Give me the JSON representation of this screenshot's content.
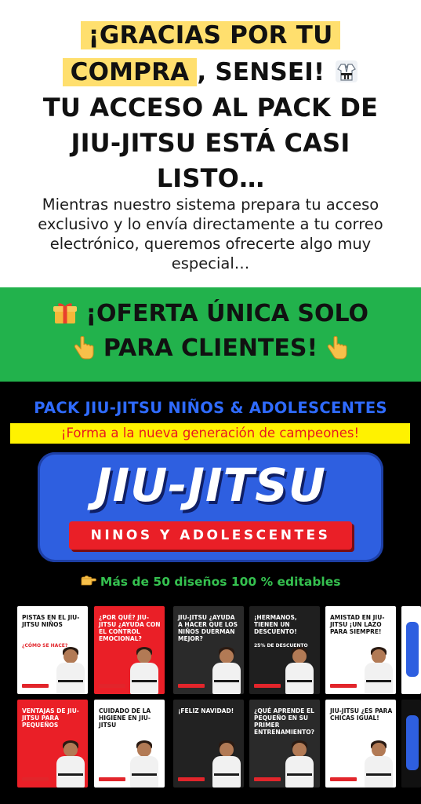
{
  "hero": {
    "line1": "¡GRACIAS POR TU",
    "line2_highlight": "COMPRA",
    "line2_rest": ", SENSEI!",
    "line3": "TU ACCESO AL PACK DE",
    "line4": "JIU-JITSU ESTÁ CASI",
    "line5": "LISTO…",
    "subtitle_line1": "Mientras nuestro sistema prepara tu acceso",
    "subtitle_line2": "exclusivo y lo envía directamente a tu correo",
    "subtitle_line3": "electrónico, queremos ofrecerte algo muy",
    "subtitle_line4": "especial…",
    "icon": "martial-arts-uniform-icon"
  },
  "offer": {
    "line1": "¡OFERTA ÚNICA SOLO",
    "line2": "PARA CLIENTES!",
    "icons": [
      "gift-icon",
      "pointing-down-icon",
      "pointing-down-icon"
    ]
  },
  "pack": {
    "title": "PACK JIU-JITSU NIÑOS & ADOLESCENTES",
    "subtitle": "¡Forma a la nueva generación de campeones!",
    "logo_title": "JIU-JITSU",
    "logo_band": "NINOS Y ADOLESCENTES",
    "designs_text": "Más de 50 diseños 100 % editables",
    "designs_icon": "pointing-right-icon"
  },
  "thumbnails_row1": [
    {
      "title": "PISTAS EN EL JIU-JITSU NIÑOS",
      "sub": "¿CÓMO SE HACE?",
      "bg": "#ffffff"
    },
    {
      "title": "¿POR QUÉ? JIU-JITSU ¿AYUDA CON EL CONTROL EMOCIONAL?",
      "sub": "",
      "bg": "#ea1f27"
    },
    {
      "title": "JIU-JITSU ¿AYUDA A HACER QUE LOS NIÑOS DUERMAN MEJOR?",
      "sub": "",
      "bg": "#2a2a2a"
    },
    {
      "title": "¡HERMANOS, TIENEN UN DESCUENTO!",
      "sub": "25% DE DESCUENTO",
      "bg": "#1f1f1f"
    },
    {
      "title": "AMISTAD EN JIU-JITSU ¡UN LAZO PARA SIEMPRE!",
      "sub": "",
      "bg": "#ffffff"
    }
  ],
  "thumbnails_row2": [
    {
      "title": "VENTAJAS DE JIU-JITSU PARA PEQUEÑOS",
      "sub": "",
      "bg": "#ea1f27"
    },
    {
      "title": "CUIDADO DE LA HIGIENE EN JIU-JITSU",
      "sub": "",
      "bg": "#ffffff"
    },
    {
      "title": "¡FELIZ NAVIDAD!",
      "sub": "",
      "bg": "#222222"
    },
    {
      "title": "¿QUÉ APRENDE EL PEQUEÑO EN SU PRIMER ENTRENAMIENTO?",
      "sub": "",
      "bg": "#2a2a2a"
    },
    {
      "title": "JIU-JITSU ¿ES PARA CHICAS IGUAL!",
      "sub": "",
      "bg": "#ffffff"
    }
  ],
  "colors": {
    "highlight": "#ffdf6e",
    "green": "#22b24c",
    "pack_blue": "#2f6bff",
    "sub_yellow": "#fff200",
    "sub_red": "#e8181f",
    "logo_blue": "#2e5fe0",
    "logo_red": "#ea1f27",
    "designs_green": "#35c14f"
  }
}
